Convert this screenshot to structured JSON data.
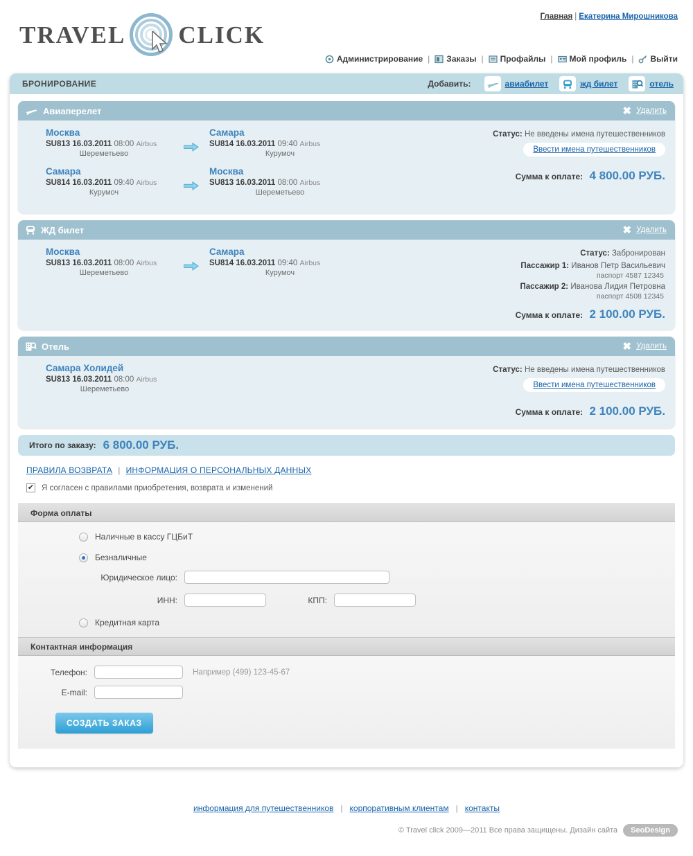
{
  "brand": {
    "word1": "TRAVEL",
    "word2": "CLICK",
    "logo_mark": "spiral-cursor-logo"
  },
  "top_links": {
    "home": "Главная",
    "separator": "|",
    "user": "Екатерина Мирошникова"
  },
  "main_nav": {
    "separator": "|",
    "items": [
      {
        "label": "Администрирование",
        "icon": "gear-icon"
      },
      {
        "label": "Заказы",
        "icon": "orders-icon"
      },
      {
        "label": "Профайлы",
        "icon": "profiles-icon"
      },
      {
        "label": "Мой профиль",
        "icon": "id-card-icon"
      },
      {
        "label": "Выйти",
        "icon": "key-icon"
      }
    ]
  },
  "panel": {
    "title": "БРОНИРОВАНИЕ",
    "add_label": "Добавить:",
    "add_items": [
      {
        "label": "авиабилет",
        "icon": "plane-icon"
      },
      {
        "label": "жд билет",
        "icon": "train-icon"
      },
      {
        "label": "отель",
        "icon": "hotel-icon"
      }
    ]
  },
  "delete": {
    "x": "✖",
    "label": "Удалить"
  },
  "arrow_icon": "arrow-right-icon",
  "blocks": [
    {
      "type": "flight",
      "icon": "plane-icon",
      "title": "Авиаперелет",
      "segments": [
        {
          "from": {
            "city": "Москва",
            "flight": "SU813",
            "date": "16.03.2011",
            "time": "08:00",
            "aircraft": "Airbus",
            "airport": "Шереметьево"
          },
          "to": {
            "city": "Самара",
            "flight": "SU814",
            "date": "16.03.2011",
            "time": "09:40",
            "aircraft": "Airbus",
            "airport": "Курумоч"
          }
        },
        {
          "from": {
            "city": "Самара",
            "flight": "SU814",
            "date": "16.03.2011",
            "time": "09:40",
            "aircraft": "Airbus",
            "airport": "Курумоч"
          },
          "to": {
            "city": "Москва",
            "flight": "SU813",
            "date": "16.03.2011",
            "time": "08:00",
            "aircraft": "Airbus",
            "airport": "Шереметьево"
          }
        }
      ],
      "status_label": "Статус:",
      "status_value": "Не введены имена путешественников",
      "names_button": "Ввести имена путешественников",
      "sum_label": "Сумма к оплате:",
      "sum_amount": "4 800.00 РУБ.",
      "passengers": []
    },
    {
      "type": "train",
      "icon": "train-icon",
      "title": "ЖД билет",
      "segments": [
        {
          "from": {
            "city": "Москва",
            "flight": "SU813",
            "date": "16.03.2011",
            "time": "08:00",
            "aircraft": "Airbus",
            "airport": "Шереметьево"
          },
          "to": {
            "city": "Самара",
            "flight": "SU814",
            "date": "16.03.2011",
            "time": "09:40",
            "aircraft": "Airbus",
            "airport": "Курумоч"
          }
        }
      ],
      "status_label": "Статус:",
      "status_value": "Забронирован",
      "names_button": null,
      "sum_label": "Сумма к оплате:",
      "sum_amount": "2 100.00 РУБ.",
      "passengers": [
        {
          "label": "Пассажир 1:",
          "name": "Иванов Петр Васильевич",
          "doc": "паспорт 4587 12345"
        },
        {
          "label": "Пассажир 2:",
          "name": "Иванова Лидия Петровна",
          "doc": "паспорт 4508 12345"
        }
      ]
    },
    {
      "type": "hotel",
      "icon": "hotel-icon",
      "title": "Отель",
      "segments": [
        {
          "from": {
            "city": "Самара Холидей",
            "flight": "SU813",
            "date": "16.03.2011",
            "time": "08:00",
            "aircraft": "Airbus",
            "airport": "Шереметьево"
          },
          "to": null
        }
      ],
      "status_label": "Статус:",
      "status_value": "Не введены имена путешественников",
      "names_button": "Ввести имена путешественников",
      "sum_label": "Сумма к оплате:",
      "sum_amount": "2 100.00 РУБ.",
      "passengers": []
    }
  ],
  "total": {
    "label": "Итого по заказу:",
    "amount": "6 800.00 РУБ."
  },
  "agreement": {
    "refund_rules_link": "ПРАВИЛА ВОЗВРАТА",
    "separator": "|",
    "personal_data_link": "ИНФОРМАЦИЯ О ПЕРСОНАЛЬНЫХ ДАННЫХ",
    "checkbox_checked": true,
    "checkbox_glyph": "✔",
    "checkbox_text": "Я согласен с правилами приобретения, возврата и изменений"
  },
  "payment": {
    "section_title": "Форма оплаты",
    "options": [
      {
        "label": "Наличные в кассу ГЦБиТ",
        "selected": false
      },
      {
        "label": "Безналичные",
        "selected": true
      },
      {
        "label": "Кредитная карта",
        "selected": false
      }
    ],
    "legal_entity_label": "Юридическое лицо:",
    "legal_entity_value": "",
    "inn_label": "ИНН:",
    "inn_value": "",
    "kpp_label": "КПП:",
    "kpp_value": ""
  },
  "contact": {
    "section_title": "Контактная информация",
    "phone_label": "Телефон:",
    "phone_value": "",
    "phone_hint": "Например (499) 123-45-67",
    "email_label": "E-mail:",
    "email_value": "",
    "submit_label": "СОЗДАТЬ ЗАКАЗ"
  },
  "footer": {
    "links": [
      "информация для путешественников",
      "корпоративным клиентам",
      "контакты"
    ],
    "separator": "|",
    "copyright": "© Travel click  2009—2011  Все права защищены.   Дизайн сайта",
    "design_badge": "SeoDesign"
  },
  "colors": {
    "accent_blue": "#3e83bd",
    "link_blue": "#1763ab",
    "panel_head": "#bfdbe4",
    "block_head": "#9fc0ce",
    "block_body": "#e6eff3",
    "total_bar": "#c9e1ea",
    "submit_top": "#7cc8ea",
    "submit_bottom": "#2c9fd6"
  }
}
